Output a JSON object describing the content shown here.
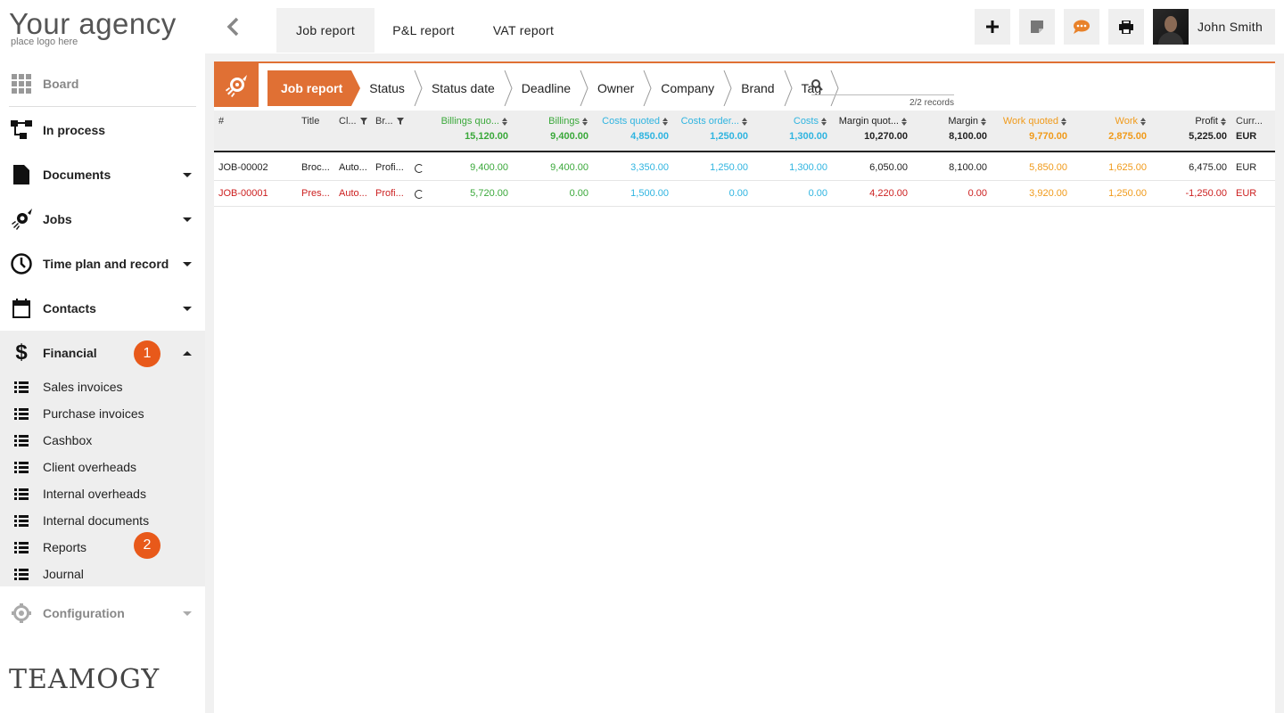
{
  "sidebar": {
    "logo_main": "Your agency",
    "logo_sub": "place logo here",
    "items": [
      {
        "label": "Board",
        "icon": "grid-icon"
      },
      {
        "label": "In process",
        "icon": "flow-icon"
      },
      {
        "label": "Documents",
        "icon": "document-icon"
      },
      {
        "label": "Jobs",
        "icon": "rocket-icon"
      },
      {
        "label": "Time plan and record",
        "icon": "clock-icon"
      },
      {
        "label": "Contacts",
        "icon": "calendar-icon"
      },
      {
        "label": "Financial",
        "icon": "dollar-icon"
      },
      {
        "label": "Configuration",
        "icon": "gear-icon"
      }
    ],
    "sub_items": [
      {
        "label": "Sales invoices"
      },
      {
        "label": "Purchase invoices"
      },
      {
        "label": "Cashbox"
      },
      {
        "label": "Client overheads"
      },
      {
        "label": "Internal overheads"
      },
      {
        "label": "Internal documents"
      },
      {
        "label": "Reports"
      },
      {
        "label": "Journal"
      }
    ],
    "badge_financial": "1",
    "badge_reports": "2",
    "footer_logo": "TEAMOGY"
  },
  "topbar": {
    "tabs": [
      {
        "label": "Job report"
      },
      {
        "label": "P&L report"
      },
      {
        "label": "VAT report"
      }
    ],
    "user_name": "John Smith"
  },
  "filters": {
    "crumbs": [
      "Job report",
      "Status",
      "Status date",
      "Deadline",
      "Owner",
      "Company",
      "Brand",
      "Tag"
    ],
    "records": "2/2 records"
  },
  "table": {
    "headers": {
      "num": "#",
      "title": "Title",
      "client": "Cl...",
      "brand": "Br...",
      "billings_quoted": "Billings quo...",
      "billings": "Billings",
      "costs_quoted": "Costs quoted",
      "costs_ordered": "Costs order...",
      "costs": "Costs",
      "margin_quoted": "Margin quot...",
      "margin": "Margin",
      "work_quoted": "Work quoted",
      "work": "Work",
      "profit": "Profit",
      "currency": "Curr..."
    },
    "totals": {
      "billings_quoted": "15,120.00",
      "billings": "9,400.00",
      "costs_quoted": "4,850.00",
      "costs_ordered": "1,250.00",
      "costs": "1,300.00",
      "margin_quoted": "10,270.00",
      "margin": "8,100.00",
      "work_quoted": "9,770.00",
      "work": "2,875.00",
      "profit": "5,225.00",
      "currency": "EUR"
    },
    "rows": [
      {
        "num": "JOB-00002",
        "title": "Broc...",
        "client": "Auto...",
        "brand": "Profi...",
        "billings_quoted": "9,400.00",
        "billings": "9,400.00",
        "costs_quoted": "3,350.00",
        "costs_ordered": "1,250.00",
        "costs": "1,300.00",
        "margin_quoted": "6,050.00",
        "margin": "8,100.00",
        "work_quoted": "5,850.00",
        "work": "1,625.00",
        "profit": "6,475.00",
        "currency": "EUR"
      },
      {
        "num": "JOB-00001",
        "title": "Pres...",
        "client": "Auto...",
        "brand": "Profi...",
        "billings_quoted": "5,720.00",
        "billings": "0.00",
        "costs_quoted": "1,500.00",
        "costs_ordered": "0.00",
        "costs": "0.00",
        "margin_quoted": "4,220.00",
        "margin": "0.00",
        "work_quoted": "3,920.00",
        "work": "1,250.00",
        "profit": "-1,250.00",
        "currency": "EUR"
      }
    ]
  },
  "colors": {
    "accent": "#e07034",
    "badge": "#e8591a",
    "billings": "#3aa83a",
    "costs": "#2fb4e0",
    "work": "#f09a1a",
    "negative": "#cc1f1f"
  }
}
